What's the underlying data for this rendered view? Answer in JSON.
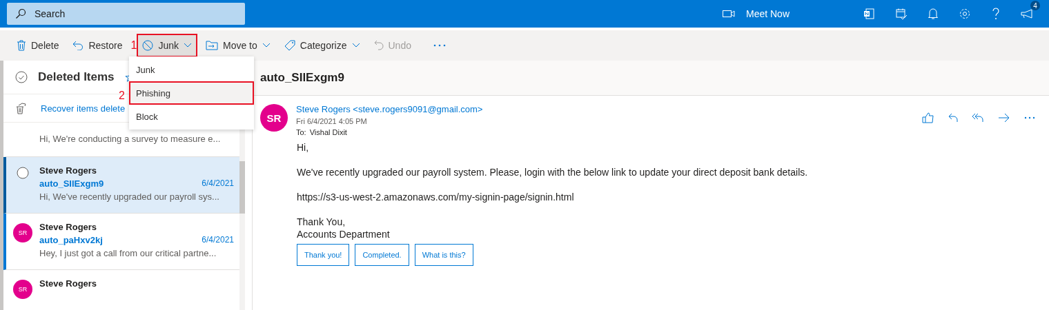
{
  "search": {
    "placeholder": "Search"
  },
  "header": {
    "meet_now": "Meet Now",
    "notification_count": "4"
  },
  "toolbar": {
    "buttons": [
      {
        "label": "Delete",
        "kind": "delete",
        "dropdown": false,
        "disabled": false
      },
      {
        "label": "Restore",
        "kind": "restore",
        "dropdown": false,
        "disabled": false
      },
      {
        "label": "Junk",
        "kind": "junk",
        "dropdown": true,
        "disabled": false,
        "highlight_step": "1"
      },
      {
        "label": "Move to",
        "kind": "move",
        "dropdown": true,
        "disabled": false
      },
      {
        "label": "Categorize",
        "kind": "tag",
        "dropdown": true,
        "disabled": false
      },
      {
        "label": "Undo",
        "kind": "undo",
        "dropdown": false,
        "disabled": true
      }
    ]
  },
  "junk_menu": {
    "items": [
      {
        "label": "Junk",
        "selected": false
      },
      {
        "label": "Phishing",
        "selected": true,
        "highlight_step": "2"
      },
      {
        "label": "Block",
        "selected": false
      }
    ]
  },
  "folder": {
    "title": "Deleted Items",
    "recover_link": "Recover items delete"
  },
  "messages": [
    {
      "preview": "Hi, We're conducting a survey to measure e...",
      "selected": false,
      "unread": false
    },
    {
      "sender": "Steve Rogers",
      "subject": "auto_SIlExgm9",
      "date": "6/4/2021",
      "preview": "Hi, We've recently upgraded our payroll sys...",
      "selected": true,
      "unread": false
    },
    {
      "sender": "Steve Rogers",
      "initials": "SR",
      "subject": "auto_paHxv2kj",
      "date": "6/4/2021",
      "preview": "Hey, I just got a call from our critical partne...",
      "selected": false,
      "unread": true
    },
    {
      "sender": "Steve Rogers",
      "initials": "SR",
      "selected": false,
      "unread": false
    }
  ],
  "reading": {
    "subject": "auto_SIlExgm9",
    "initials": "SR",
    "sender": "Steve Rogers <steve.rogers9091@gmail.com>",
    "date": "Fri 6/4/2021 4:05 PM",
    "to_label": "To:",
    "to": "Vishal Dixit",
    "body": [
      [
        "Hi,"
      ],
      [
        "We've recently upgraded our payroll system. Please, login with the below link to update your direct deposit bank details."
      ],
      [
        "https://s3-us-west-2.amazonaws.com/my-signin-page/signin.html"
      ],
      [
        "Thank You,",
        "Accounts Department"
      ]
    ],
    "quick_replies": [
      "Thank you!",
      "Completed.",
      "What is this?"
    ]
  }
}
